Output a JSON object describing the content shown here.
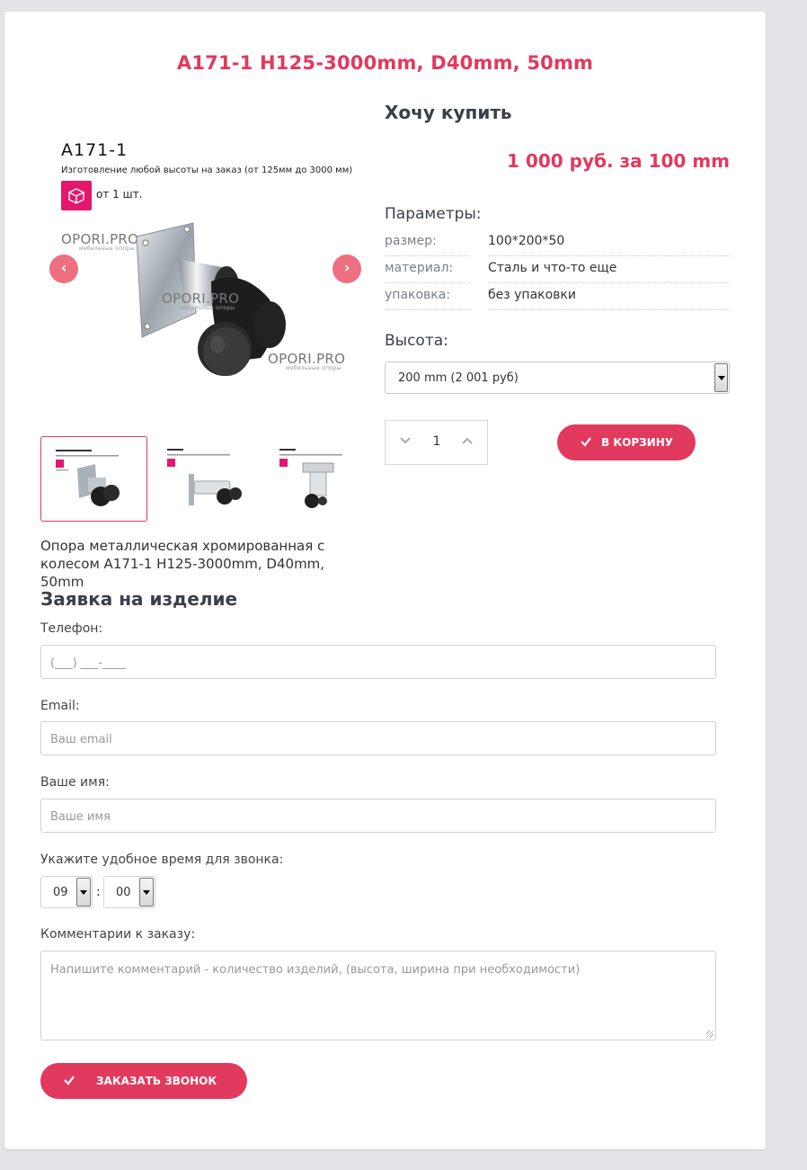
{
  "product": {
    "title": "A171-1 H125-3000mm, D40mm, 50mm",
    "description": "Опора металлическая хромированная с колесом A171-1 H125-3000mm, D40mm, 50mm"
  },
  "gallery": {
    "model": "A171-1",
    "subtitle": "Изготовление любой высоты на заказ (от 125мм до 3000 мм)",
    "min_order": "от 1 шт.",
    "watermark": "OPORI.PRO",
    "watermark_sub": "мебельные опоры",
    "prev_arrow": "‹",
    "next_arrow": "›",
    "thumb_count": 3,
    "active_thumb": 0
  },
  "purchase": {
    "heading": "Хочу купить",
    "price": "1 000 руб. за 100 mm",
    "params_heading": "Параметры:",
    "params": [
      {
        "key": "размер:",
        "value": "100*200*50"
      },
      {
        "key": "материал:",
        "value": "Сталь и что-то еще"
      },
      {
        "key": "упаковка:",
        "value": "без упаковки"
      }
    ],
    "height_heading": "Высота:",
    "height_selected": "200 mm (2 001 руб)",
    "quantity": "1",
    "qty_minus_icon": "chevron-down",
    "qty_plus_icon": "chevron-up",
    "cart_button": "В корзину"
  },
  "form": {
    "heading": "Заявка на изделие",
    "phone_label": "Телефон:",
    "phone_placeholder": "(___) ___-____",
    "email_label": "Email:",
    "email_placeholder": "Ваш email",
    "name_label": "Ваше имя:",
    "name_placeholder": "Ваше имя",
    "time_label": "Укажите удобное время для звонка:",
    "time_hour": "09",
    "time_separator": ":",
    "time_minute": "00",
    "comment_label": "Комментарии к заказу:",
    "comment_placeholder": "Напишите комментарий - количество изделий, (высота, ширина при необходимости)",
    "submit_button": "Заказать звонок"
  },
  "colors": {
    "accent": "#e2395f",
    "arrow_bg": "#ee7080",
    "badge": "#e2186c",
    "page_bg": "#e4e4e8"
  }
}
